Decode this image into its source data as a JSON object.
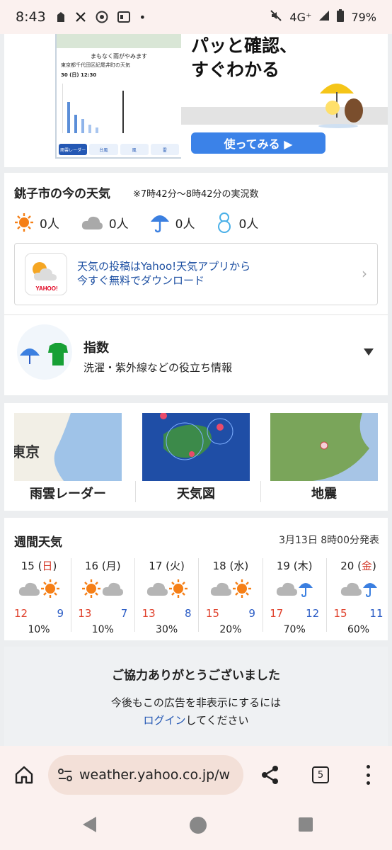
{
  "status_bar": {
    "time": "8:43",
    "network": "4G⁺",
    "battery": "79%"
  },
  "ad": {
    "phone": {
      "title": "まもなく雨がやみます",
      "location": "東京都千代田区紀尾井町の天気",
      "time_row": "30 (日)  12:30",
      "tabs": [
        "雨雲レーダー",
        "台風",
        "風",
        "雷"
      ]
    },
    "headline_line1": "パッと確認、",
    "headline_line2": "すぐわかる",
    "cta": "使ってみる ▶"
  },
  "now_weather": {
    "title": "銚子市の今の天気",
    "note": "※7時42分〜8時42分の実況数",
    "counts": [
      {
        "icon": "sun-icon",
        "value": "0人"
      },
      {
        "icon": "cloud-icon",
        "value": "0人"
      },
      {
        "icon": "umbrella-icon",
        "value": "0人"
      },
      {
        "icon": "snowman-icon",
        "value": "0人"
      }
    ],
    "promo_line1": "天気の投稿はYahoo!天気アプリから",
    "promo_line2": "今すぐ無料でダウンロード",
    "promo_logo": "YAHOO!"
  },
  "index": {
    "title": "指数",
    "subtitle": "洗濯・紫外線などの役立ち情報"
  },
  "maps": {
    "radar": "雨雲レーダー",
    "weather_map": "天気図",
    "earthquake": "地震",
    "radar_map_text": "東京"
  },
  "weekly": {
    "title": "週間天気",
    "issued": "3月13日 8時00分発表",
    "days": [
      {
        "date": "15",
        "weekday": "日",
        "weekday_red": true,
        "icons": [
          "cloud-icon",
          "sun-icon"
        ],
        "high": "12",
        "low": "9",
        "pop": "10%"
      },
      {
        "date": "16",
        "weekday": "月",
        "weekday_red": false,
        "icons": [
          "sun-icon",
          "cloud-icon"
        ],
        "high": "13",
        "low": "7",
        "pop": "10%"
      },
      {
        "date": "17",
        "weekday": "火",
        "weekday_red": false,
        "icons": [
          "cloud-icon",
          "sun-icon"
        ],
        "high": "13",
        "low": "8",
        "pop": "30%"
      },
      {
        "date": "18",
        "weekday": "水",
        "weekday_red": false,
        "icons": [
          "cloud-icon",
          "sun-icon"
        ],
        "high": "15",
        "low": "9",
        "pop": "20%"
      },
      {
        "date": "19",
        "weekday": "木",
        "weekday_red": false,
        "icons": [
          "cloud-icon",
          "umbrella-icon"
        ],
        "high": "17",
        "low": "12",
        "pop": "70%"
      },
      {
        "date": "20",
        "weekday": "金",
        "weekday_red": true,
        "icons": [
          "cloud-icon",
          "umbrella-icon"
        ],
        "high": "15",
        "low": "11",
        "pop": "60%"
      }
    ]
  },
  "thanks": {
    "heading": "ご協力ありがとうございました",
    "line1": "今後もこの広告を非表示にするには",
    "link": "ログイン",
    "line2_rest": "してください"
  },
  "browser": {
    "url": "weather.yahoo.co.jp/w",
    "tab_count": "5"
  }
}
